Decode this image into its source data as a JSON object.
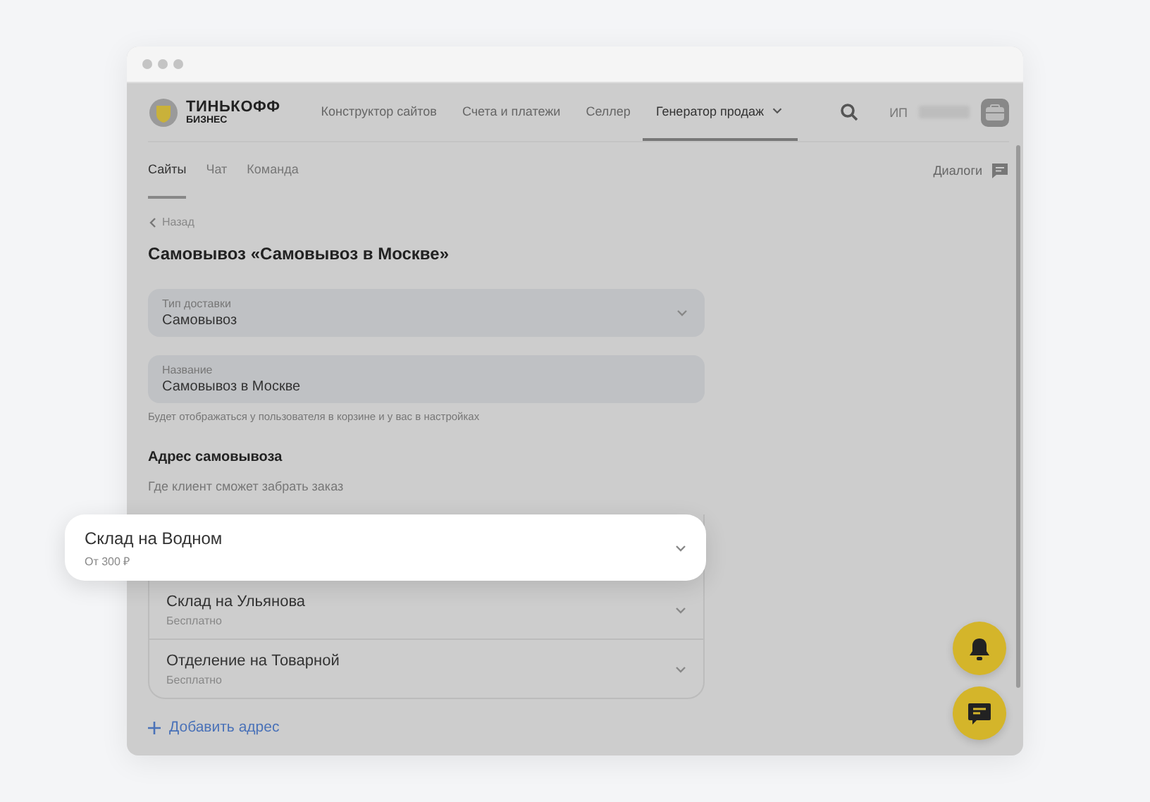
{
  "logo": {
    "title": "ТИНЬКОФФ",
    "subtitle": "БИЗНЕС"
  },
  "nav": [
    {
      "label": "Конструктор сайтов",
      "selected": false,
      "dropdown": false
    },
    {
      "label": "Счета и платежи",
      "selected": false,
      "dropdown": false
    },
    {
      "label": "Селлер",
      "selected": false,
      "dropdown": false
    },
    {
      "label": "Генератор продаж",
      "selected": true,
      "dropdown": true
    }
  ],
  "user": {
    "prefix": "ИП"
  },
  "subtabs": [
    {
      "label": "Сайты",
      "selected": true
    },
    {
      "label": "Чат",
      "selected": false
    },
    {
      "label": "Команда",
      "selected": false
    }
  ],
  "dialogs": {
    "label": "Диалоги"
  },
  "back": "Назад",
  "title": "Самовывоз «Самовывоз в Москве»",
  "fields": [
    {
      "kind": "select",
      "label": "Тип доставки",
      "value": "Самовывоз"
    },
    {
      "kind": "text",
      "label": "Название",
      "value": "Самовывоз в Москве",
      "hint": "Будет отображаться у пользователя в корзине и у вас в настройках"
    }
  ],
  "section": {
    "title": "Адрес самовывоза",
    "subtitle": "Где клиент сможет забрать заказ"
  },
  "addresses": [
    {
      "name": "Склад на Водном",
      "price": "От 300 ₽",
      "highlighted": true
    },
    {
      "name": "Склад на Ульянова",
      "price": "Бесплатно",
      "highlighted": false
    },
    {
      "name": "Отделение на Товарной",
      "price": "Бесплатно",
      "highlighted": false
    }
  ],
  "add_button": "Добавить адрес"
}
